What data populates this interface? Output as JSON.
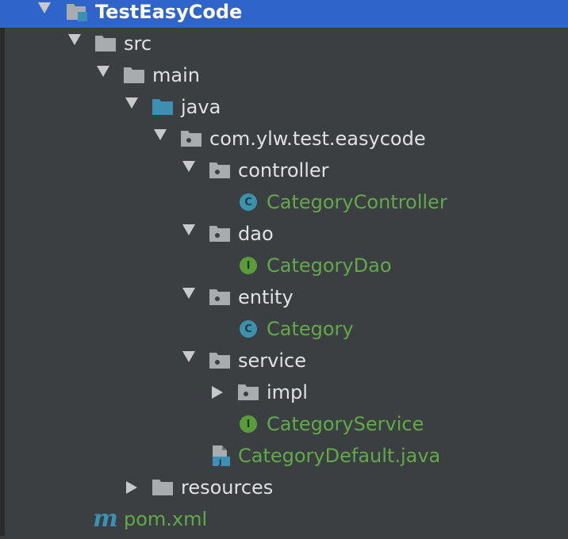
{
  "project_tree": {
    "colors": {
      "background": "#3c3f41",
      "selection": "#2f65ca",
      "text": "#dfe1e5",
      "class_text": "#62a94b",
      "folder": "#a9acae",
      "source_folder": "#3d90b4",
      "class_icon": "#3d91ad",
      "interface_icon": "#5a9c3b"
    },
    "items": [
      {
        "label": "TestEasyCode",
        "icon": "module-folder-icon",
        "expanded": true,
        "selected": true
      },
      {
        "label": "src",
        "icon": "folder-icon",
        "expanded": true
      },
      {
        "label": "main",
        "icon": "folder-icon",
        "expanded": true
      },
      {
        "label": "java",
        "icon": "source-folder-icon",
        "expanded": true
      },
      {
        "label": "com.ylw.test.easycode",
        "icon": "package-icon",
        "expanded": true
      },
      {
        "label": "controller",
        "icon": "package-icon",
        "expanded": true
      },
      {
        "label": "CategoryController",
        "icon": "class-icon",
        "icon_letter": "C"
      },
      {
        "label": "dao",
        "icon": "package-icon",
        "expanded": true
      },
      {
        "label": "CategoryDao",
        "icon": "interface-icon",
        "icon_letter": "I"
      },
      {
        "label": "entity",
        "icon": "package-icon",
        "expanded": true
      },
      {
        "label": "Category",
        "icon": "class-icon",
        "icon_letter": "C"
      },
      {
        "label": "service",
        "icon": "package-icon",
        "expanded": true
      },
      {
        "label": "impl",
        "icon": "package-icon",
        "expanded": false
      },
      {
        "label": "CategoryService",
        "icon": "interface-icon",
        "icon_letter": "I"
      },
      {
        "label": "CategoryDefault.java",
        "icon": "java-file-icon"
      },
      {
        "label": "resources",
        "icon": "folder-icon",
        "expanded": false
      },
      {
        "label": "pom.xml",
        "icon": "maven-icon",
        "icon_letter": "m"
      }
    ]
  }
}
